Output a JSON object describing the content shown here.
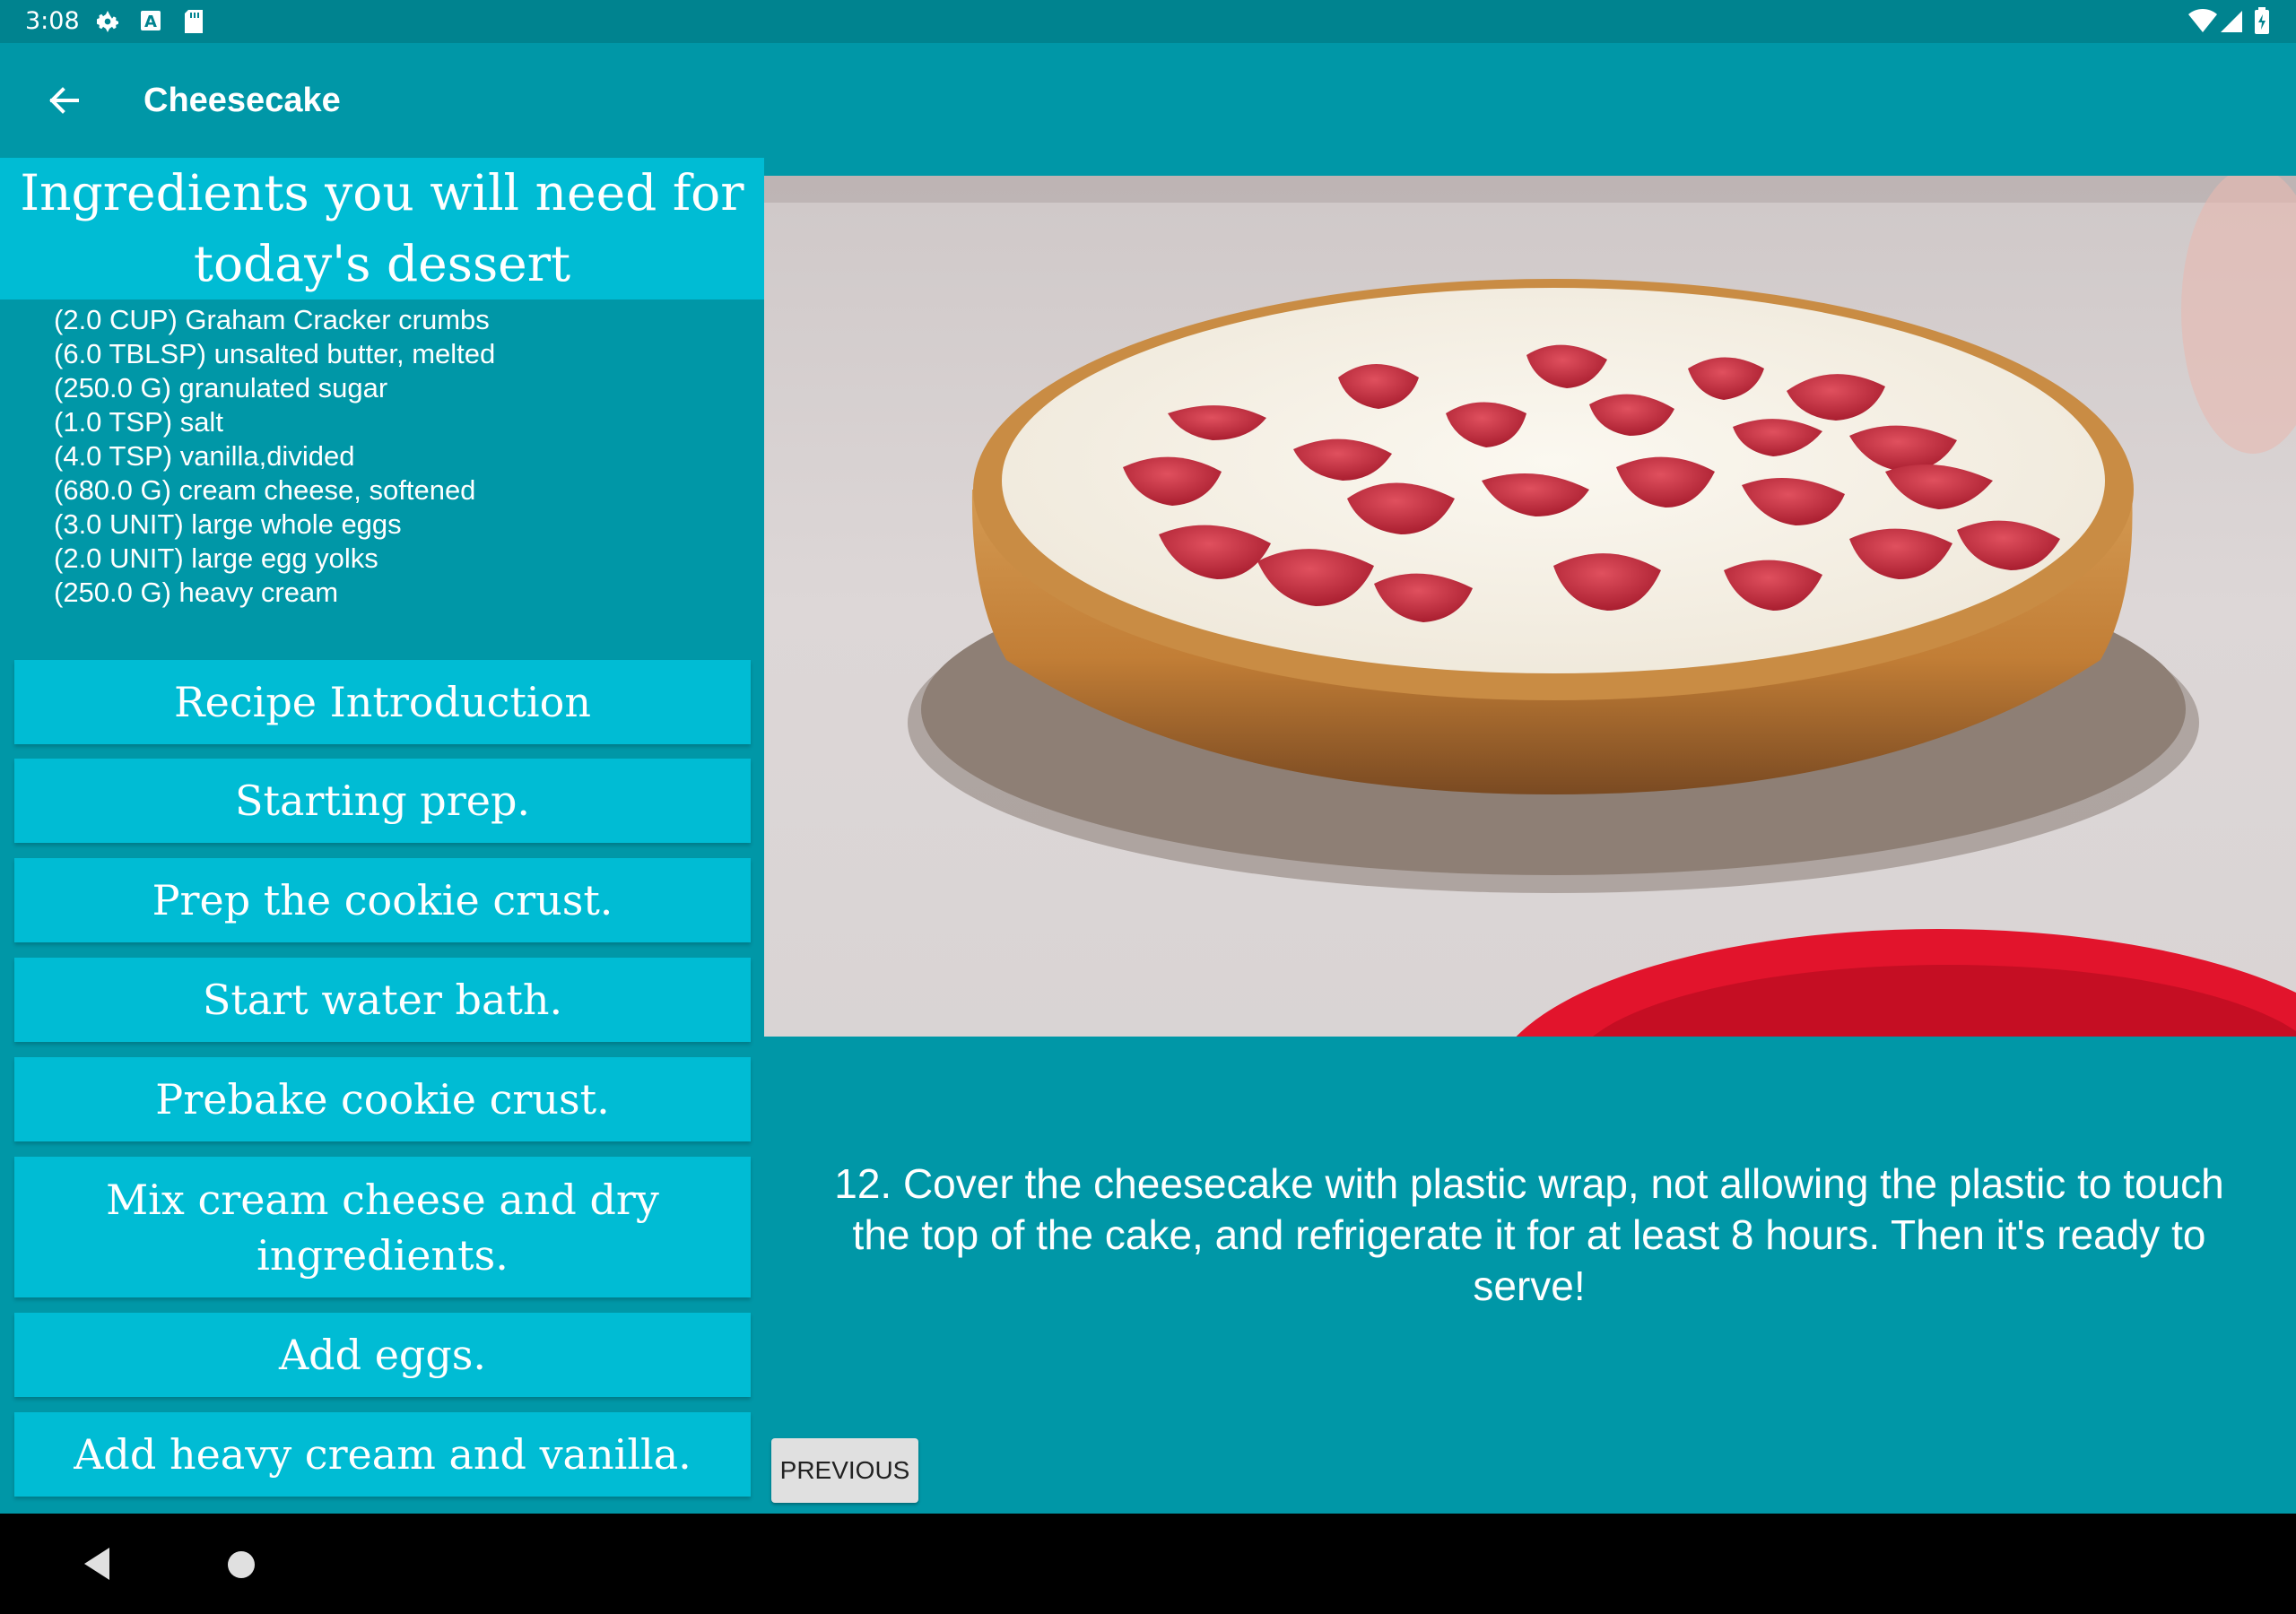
{
  "status_bar": {
    "time": "3:08",
    "left_icons": [
      "settings-icon",
      "text-a-icon",
      "sd-card-icon"
    ],
    "right_icons": [
      "wifi-icon",
      "signal-icon",
      "battery-icon"
    ]
  },
  "app_bar": {
    "title": "Cheesecake",
    "back_icon": "arrow-back-icon"
  },
  "ingredients": {
    "header": "Ingredients you will need for today's dessert",
    "items": [
      "(2.0 CUP) Graham Cracker crumbs",
      "(6.0 TBLSP) unsalted butter, melted",
      "(250.0 G) granulated sugar",
      "(1.0 TSP) salt",
      "(4.0 TSP) vanilla,divided",
      "(680.0 G) cream cheese, softened",
      "(3.0 UNIT) large whole eggs",
      "(2.0 UNIT) large egg yolks",
      "(250.0 G) heavy cream"
    ]
  },
  "steps": [
    "Recipe Introduction",
    "Starting prep.",
    "Prep the cookie crust.",
    "Start water bath.",
    "Prebake cookie crust.",
    "Mix cream cheese and dry ingredients.",
    "Add eggs.",
    "Add heavy cream and vanilla."
  ],
  "detail": {
    "description": "12. Cover the cheesecake with plastic wrap, not allowing the plastic to touch the top of the cake, and refrigerate it for at least 8 hours. Then it's ready to serve!",
    "previous_label": "PREVIOUS"
  },
  "nav_bar": {
    "icons": [
      "nav-back-icon",
      "nav-home-icon"
    ]
  },
  "colors": {
    "primary": "#0097a7",
    "primary_dark": "#00838f",
    "accent": "#00bcd4"
  }
}
